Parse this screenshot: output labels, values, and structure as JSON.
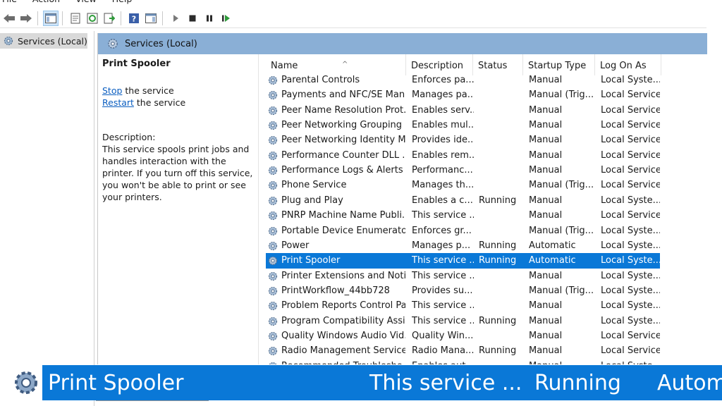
{
  "menu": [
    "File",
    "Action",
    "View",
    "Help"
  ],
  "toolbar": {
    "icons": [
      "back-arrow-icon",
      "forward-arrow-icon",
      "console-tree-icon",
      "properties-icon",
      "refresh-icon",
      "export-list-icon",
      "help-icon",
      "action-pane-icon",
      "start-service-icon",
      "stop-service-icon",
      "pause-service-icon",
      "restart-service-icon"
    ]
  },
  "tree": {
    "root_label": "Services (Local)"
  },
  "panel": {
    "header_title": "Services (Local)",
    "selected_title": "Print Spooler",
    "stop_link": "Stop",
    "stop_suffix": " the service",
    "restart_link": "Restart",
    "restart_suffix": " the service",
    "description_label": "Description:",
    "description_text": "This service spools print jobs and handles interaction with the printer. If you turn off this service, you won't be able to print or see your printers."
  },
  "table": {
    "columns": [
      "Name",
      "Description",
      "Status",
      "Startup Type",
      "Log On As"
    ],
    "rows": [
      {
        "name": "Parental Controls",
        "desc": "Enforces pa...",
        "status": "",
        "startup": "Manual",
        "logon": "Local Syste..."
      },
      {
        "name": "Payments and NFC/SE Man...",
        "desc": "Manages pa...",
        "status": "",
        "startup": "Manual (Trig...",
        "logon": "Local Service"
      },
      {
        "name": "Peer Name Resolution Prot...",
        "desc": "Enables serv...",
        "status": "",
        "startup": "Manual",
        "logon": "Local Service"
      },
      {
        "name": "Peer Networking Grouping",
        "desc": "Enables mul...",
        "status": "",
        "startup": "Manual",
        "logon": "Local Service"
      },
      {
        "name": "Peer Networking Identity M...",
        "desc": "Provides ide...",
        "status": "",
        "startup": "Manual",
        "logon": "Local Service"
      },
      {
        "name": "Performance Counter DLL ...",
        "desc": "Enables rem...",
        "status": "",
        "startup": "Manual",
        "logon": "Local Service"
      },
      {
        "name": "Performance Logs & Alerts",
        "desc": "Performanc...",
        "status": "",
        "startup": "Manual",
        "logon": "Local Service"
      },
      {
        "name": "Phone Service",
        "desc": "Manages th...",
        "status": "",
        "startup": "Manual (Trig...",
        "logon": "Local Service"
      },
      {
        "name": "Plug and Play",
        "desc": "Enables a c...",
        "status": "Running",
        "startup": "Manual",
        "logon": "Local Syste..."
      },
      {
        "name": "PNRP Machine Name Publi...",
        "desc": "This service ...",
        "status": "",
        "startup": "Manual",
        "logon": "Local Service"
      },
      {
        "name": "Portable Device Enumerator...",
        "desc": "Enforces gr...",
        "status": "",
        "startup": "Manual (Trig...",
        "logon": "Local Syste..."
      },
      {
        "name": "Power",
        "desc": "Manages p...",
        "status": "Running",
        "startup": "Automatic",
        "logon": "Local Syste..."
      },
      {
        "name": "Print Spooler",
        "desc": "This service ...",
        "status": "Running",
        "startup": "Automatic",
        "logon": "Local Syste...",
        "selected": true
      },
      {
        "name": "Printer Extensions and Notif...",
        "desc": "This service ...",
        "status": "",
        "startup": "Manual",
        "logon": "Local Syste..."
      },
      {
        "name": "PrintWorkflow_44bb728",
        "desc": "Provides su...",
        "status": "",
        "startup": "Manual (Trig...",
        "logon": "Local Syste..."
      },
      {
        "name": "Problem Reports Control Pa...",
        "desc": "This service ...",
        "status": "",
        "startup": "Manual",
        "logon": "Local Syste..."
      },
      {
        "name": "Program Compatibility Assi...",
        "desc": "This service ...",
        "status": "Running",
        "startup": "Manual",
        "logon": "Local Syste..."
      },
      {
        "name": "Quality Windows Audio Vid...",
        "desc": "Quality Win...",
        "status": "",
        "startup": "Manual",
        "logon": "Local Service"
      },
      {
        "name": "Radio Management Service",
        "desc": "Radio Mana...",
        "status": "Running",
        "startup": "Manual",
        "logon": "Local Service"
      },
      {
        "name": "Recommended Troublesho...",
        "desc": "Enables aut...",
        "status": "",
        "startup": "Manual",
        "logon": "Local Syste..."
      }
    ]
  },
  "zoom_bar": {
    "name": "Print Spooler",
    "desc": "This service ...",
    "status": "Running",
    "startup": "Autom"
  },
  "colors": {
    "selection": "#0a78d7",
    "header": "#8aafd6",
    "link": "#0b5ec0"
  }
}
